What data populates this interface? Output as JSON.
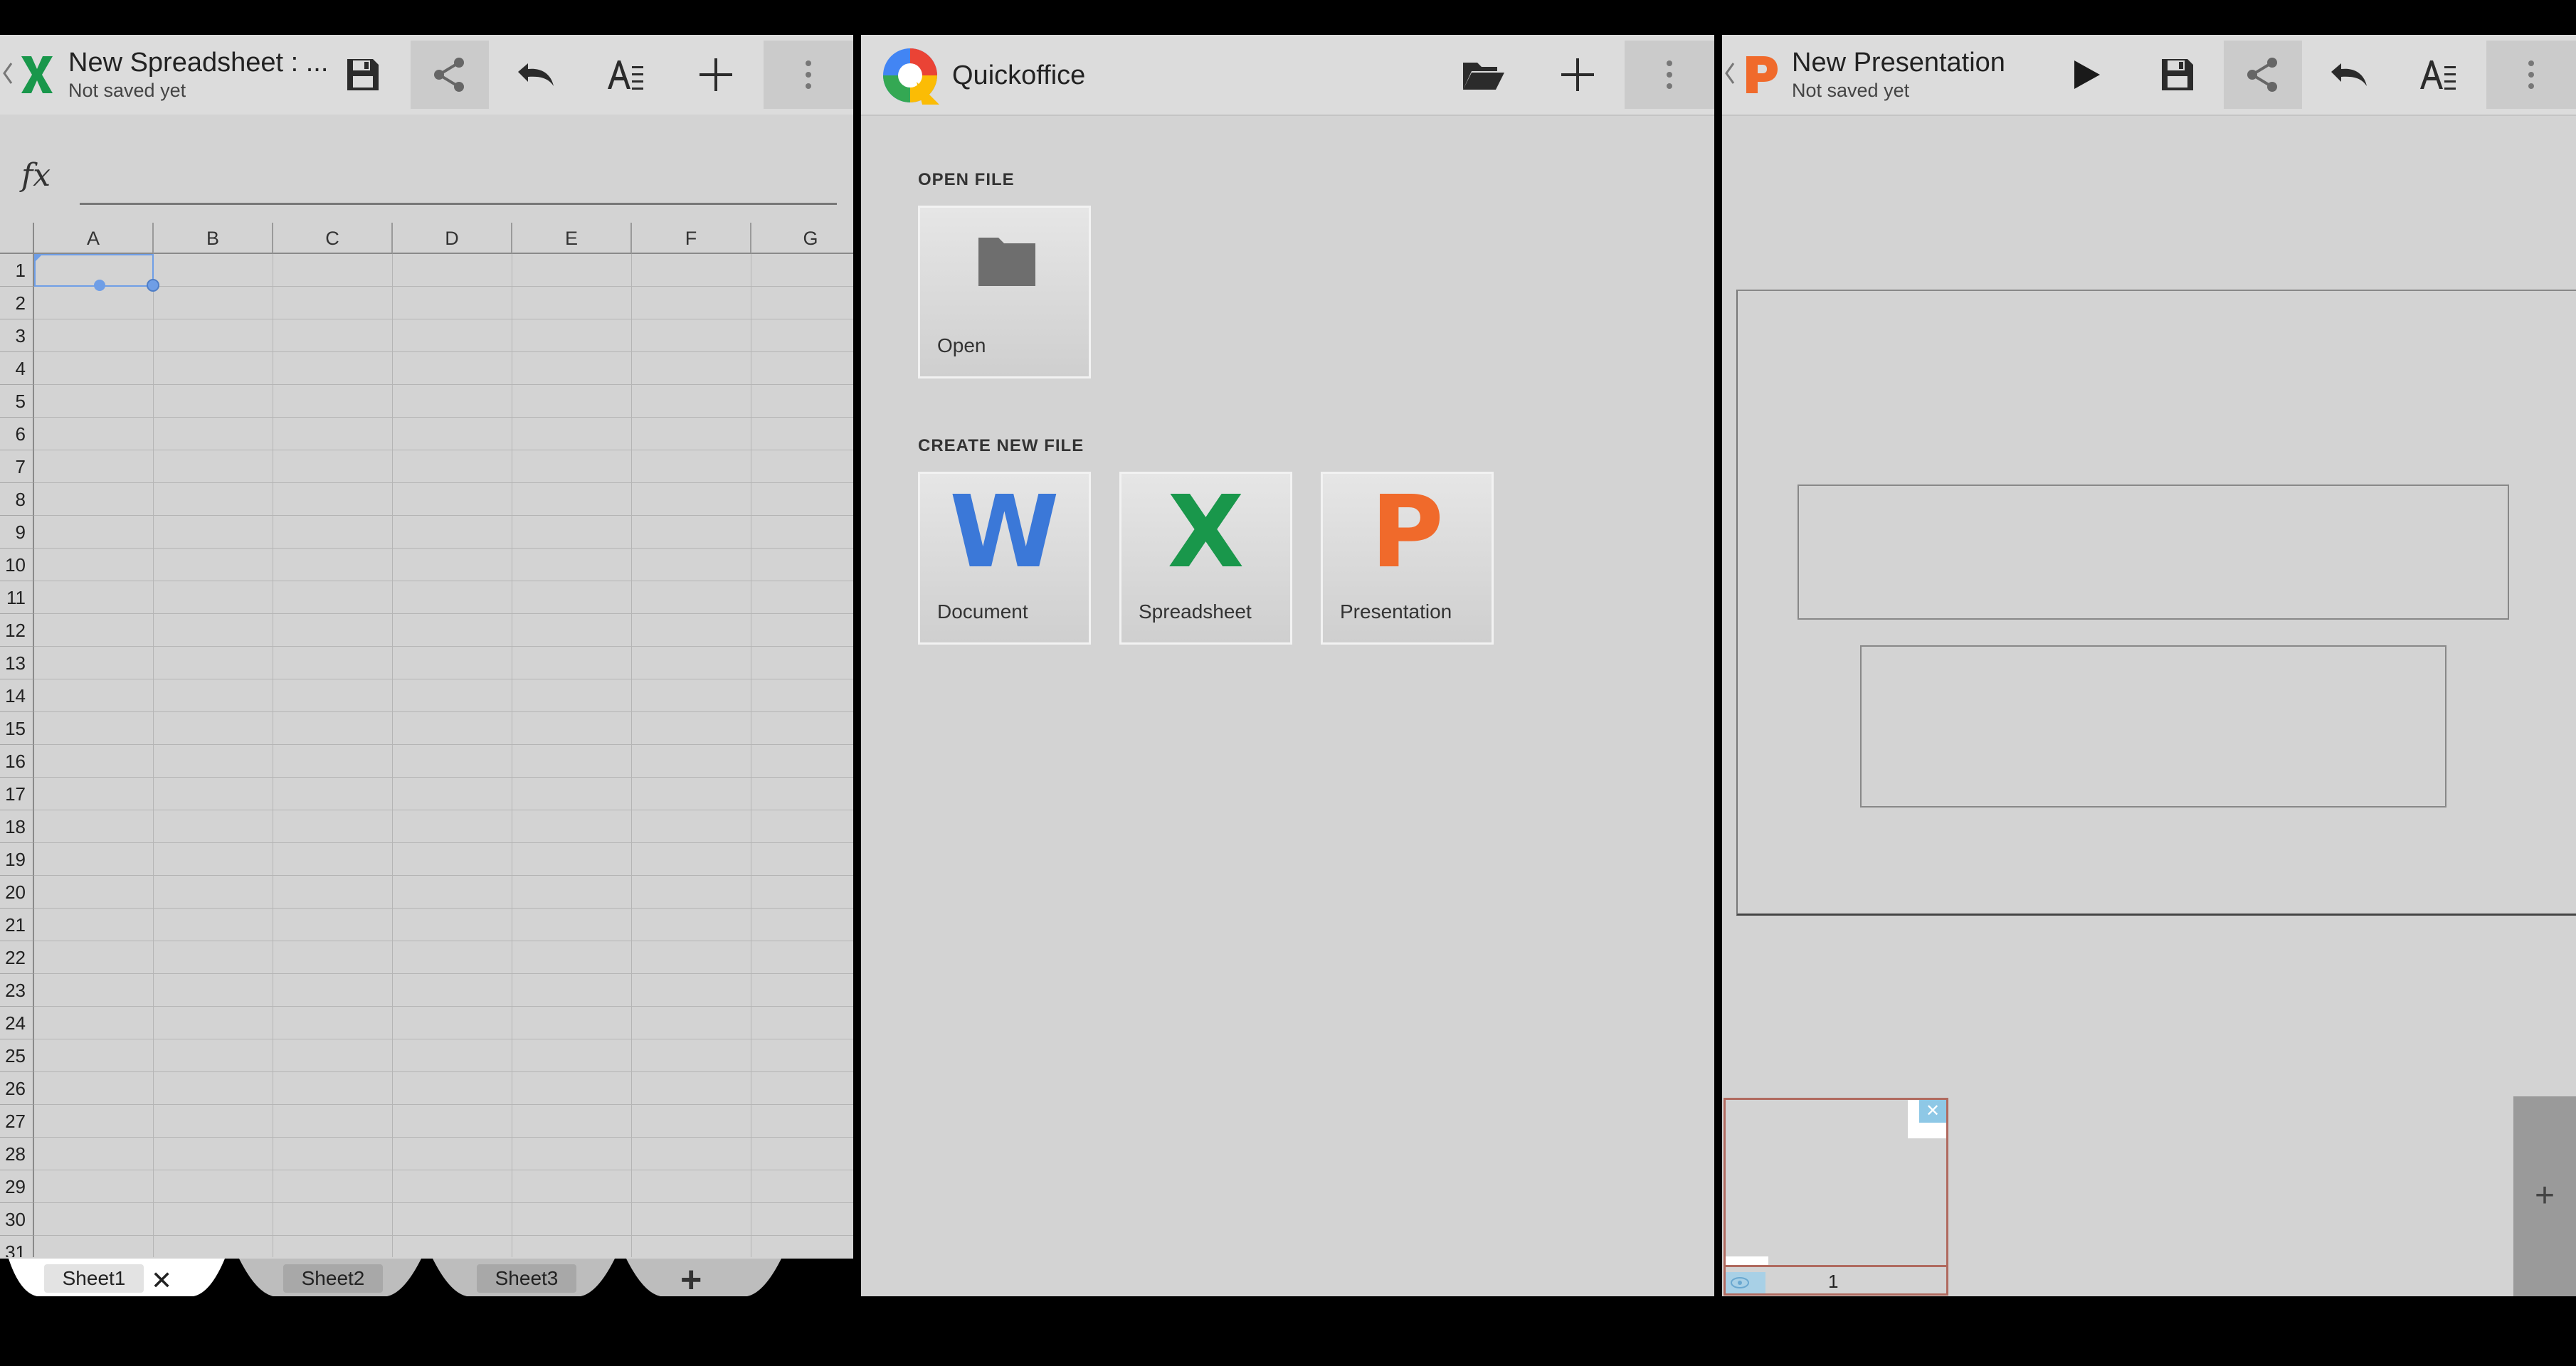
{
  "spreadsheet": {
    "title": "New Spreadsheet : ...",
    "subtitle": "Not saved yet",
    "fx_label": "fx",
    "columns": [
      "A",
      "B",
      "C",
      "D",
      "E",
      "F",
      "G"
    ],
    "rows": [
      "1",
      "2",
      "3",
      "4",
      "5",
      "6",
      "7",
      "8",
      "9",
      "10",
      "11",
      "12",
      "13",
      "14",
      "15",
      "16",
      "17",
      "18",
      "19",
      "20",
      "21",
      "22",
      "23",
      "24",
      "25",
      "26",
      "27",
      "28",
      "29",
      "30",
      "31"
    ],
    "sheet_tabs": [
      "Sheet1",
      "Sheet2",
      "Sheet3"
    ],
    "add_sheet": "+",
    "close_tab": "✕",
    "icons": [
      "back-chevron-icon",
      "excel-x-icon",
      "save-icon",
      "share-icon",
      "undo-icon",
      "text-format-icon",
      "add-icon",
      "overflow-menu-icon"
    ]
  },
  "quickoffice": {
    "app_title": "Quickoffice",
    "open_section": "OPEN FILE",
    "open_tile": "Open",
    "create_section": "CREATE NEW FILE",
    "create_tiles": [
      {
        "label": "Document",
        "letter": "W",
        "color": "#3b78d8"
      },
      {
        "label": "Spreadsheet",
        "letter": "X",
        "color": "#19974b"
      },
      {
        "label": "Presentation",
        "letter": "P",
        "color": "#f06a2b"
      }
    ],
    "icons": [
      "quickoffice-logo-icon",
      "folder-open-icon",
      "add-icon",
      "overflow-menu-icon"
    ]
  },
  "presentation": {
    "title": "New Presentation",
    "subtitle": "Not saved yet",
    "slide_number": "1",
    "add_slide": "+",
    "thumb_close": "✕",
    "icons": [
      "back-chevron-icon",
      "powerpoint-p-icon",
      "play-icon",
      "save-icon",
      "share-icon",
      "undo-icon",
      "text-format-icon",
      "overflow-menu-icon"
    ]
  },
  "colors": {
    "excel_green": "#19974b",
    "word_blue": "#3b78d8",
    "ppt_orange": "#f06a2b",
    "selection_blue": "#6f9ee6",
    "thumb_border": "#b06a5f"
  }
}
